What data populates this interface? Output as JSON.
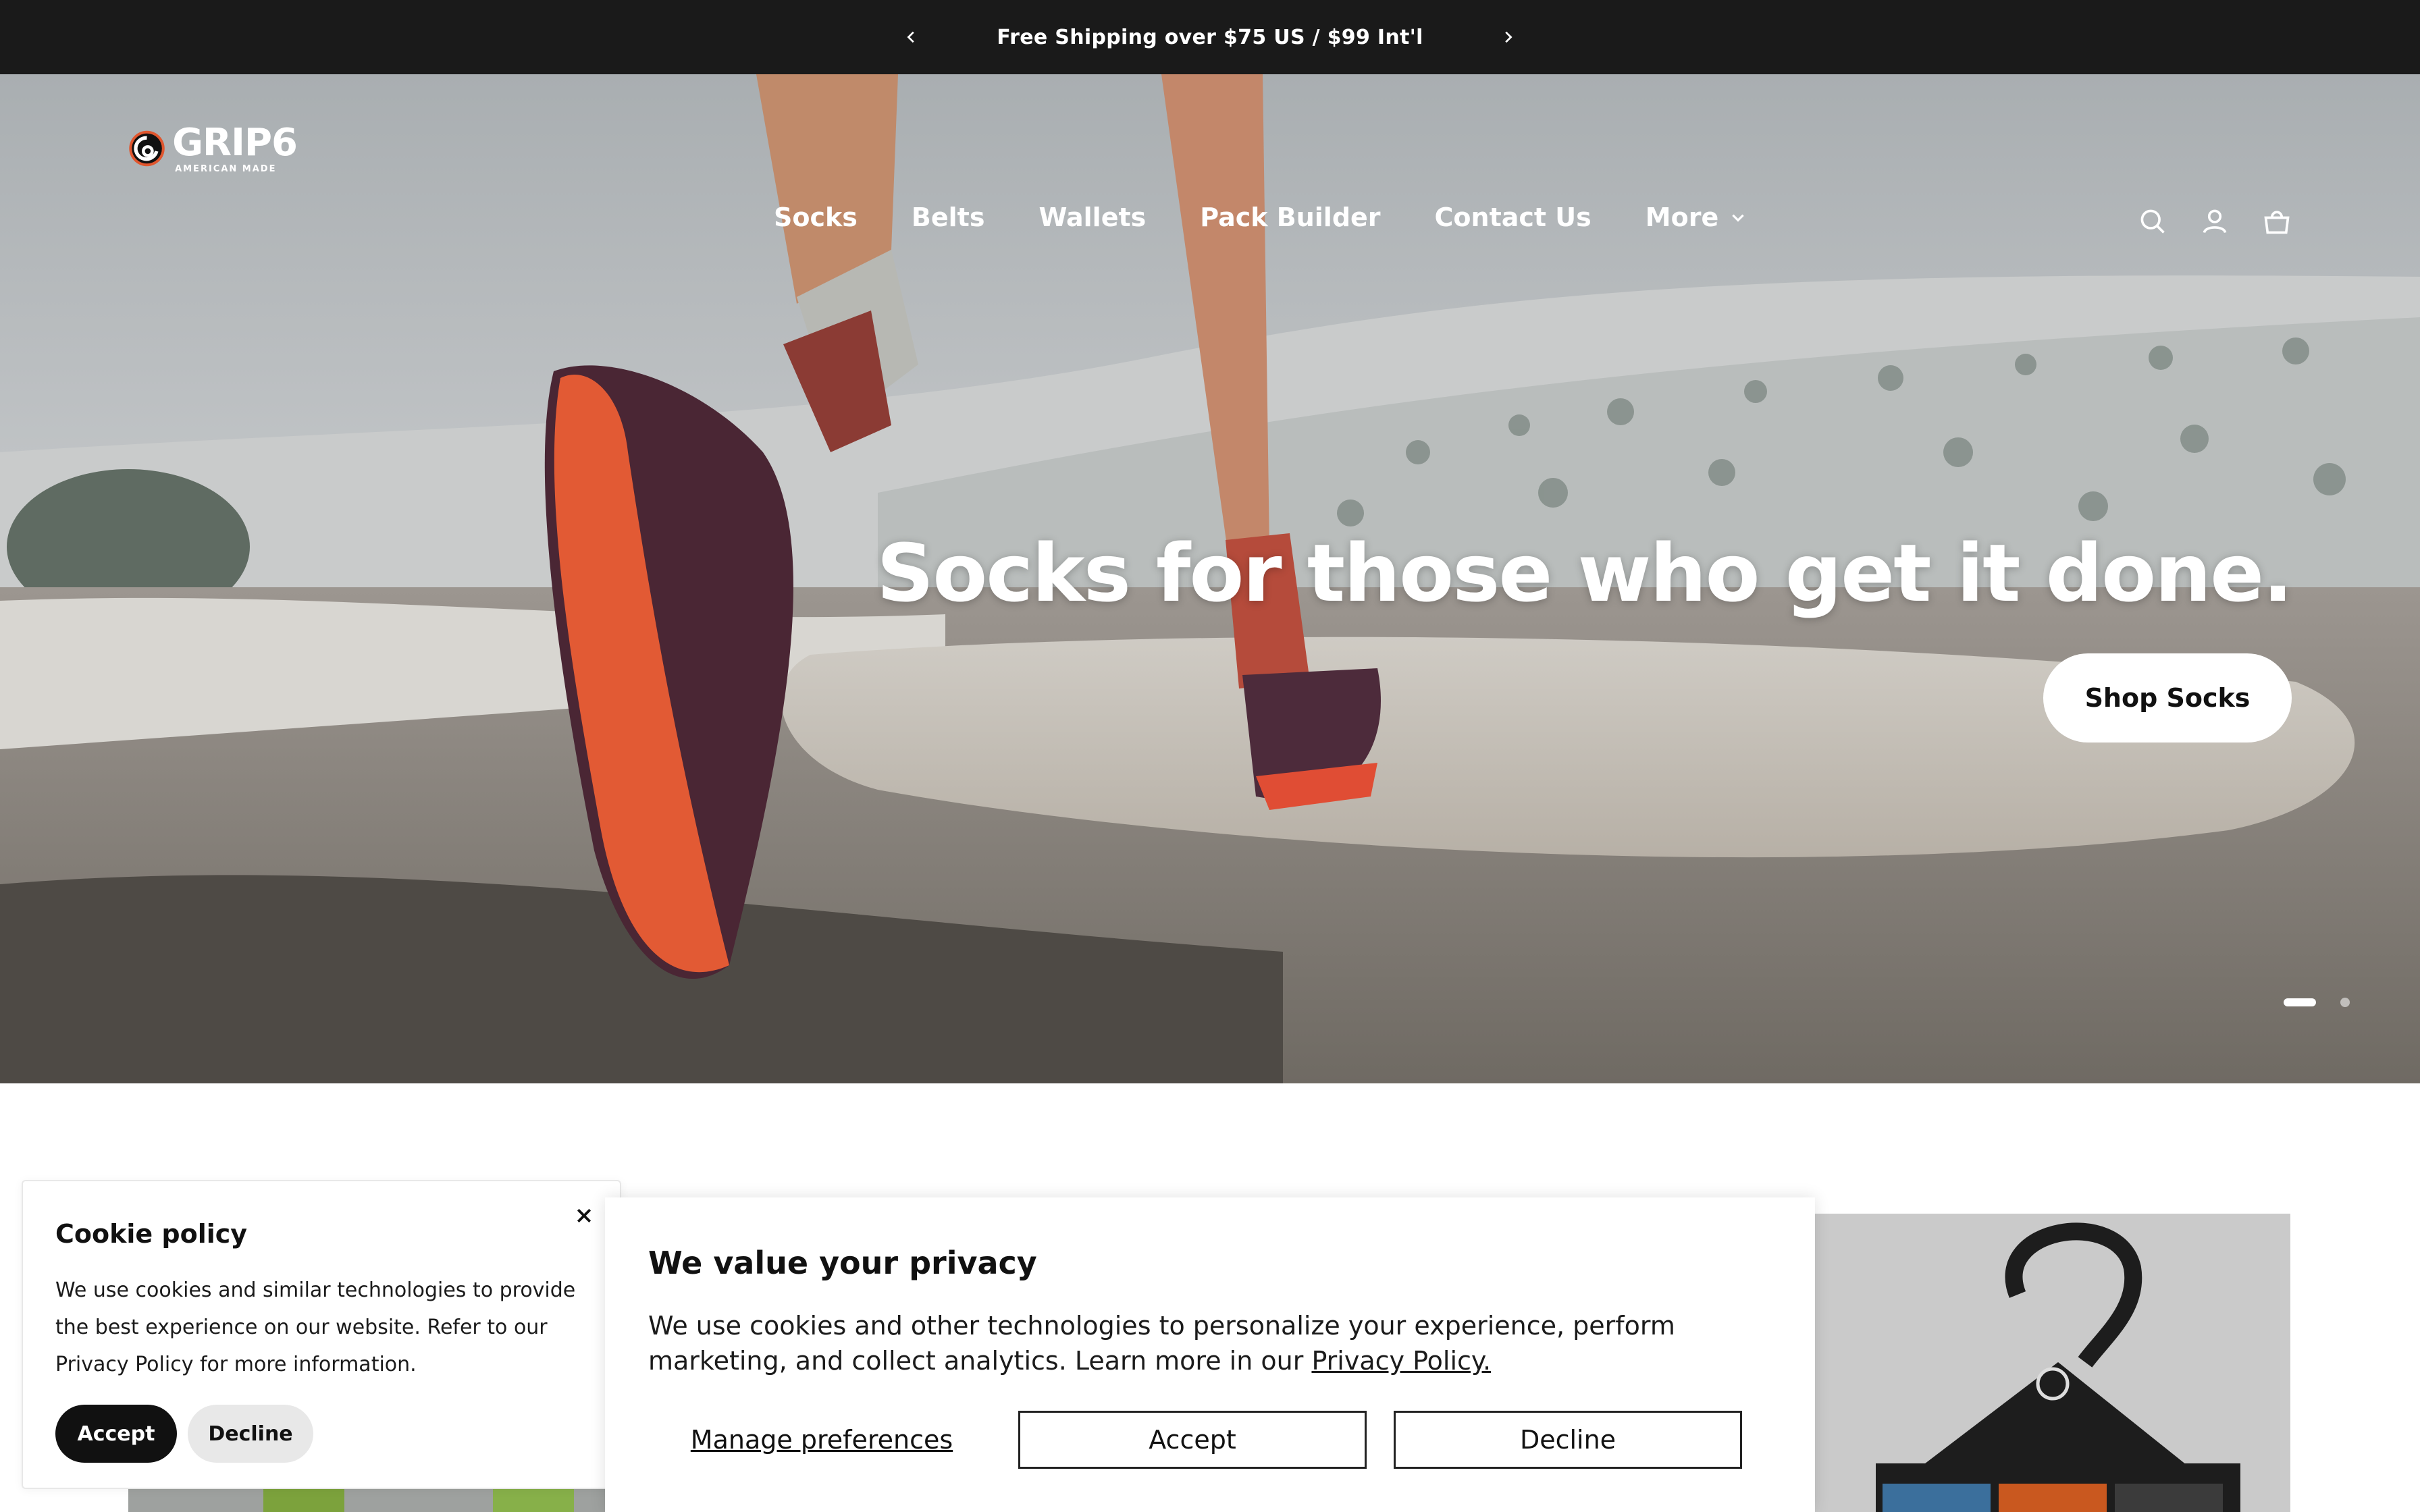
{
  "announcement": {
    "text": "Free Shipping over $75 US / $99 Int'l",
    "prev_icon": "chevron-left-icon",
    "next_icon": "chevron-right-icon"
  },
  "header": {
    "logo": {
      "word": "GRIP6",
      "tagline": "AMERICAN MADE"
    },
    "nav": [
      {
        "label": "Socks"
      },
      {
        "label": "Belts"
      },
      {
        "label": "Wallets"
      },
      {
        "label": "Pack Builder"
      },
      {
        "label": "Contact Us"
      },
      {
        "label": "More"
      }
    ],
    "icons": [
      "search-icon",
      "account-icon",
      "cart-icon"
    ]
  },
  "hero": {
    "title": "Socks for those who get it done.",
    "cta": "Shop Socks",
    "slides": 2,
    "active_slide": 1
  },
  "cookie_policy": {
    "title": "Cookie policy",
    "body": "We use cookies and similar technologies to provide the best experience on our website. Refer to our Privacy Policy for more information.",
    "accept": "Accept",
    "decline": "Decline"
  },
  "privacy_banner": {
    "title": "We value your privacy",
    "body": "We use cookies and other technologies to personalize your experience, perform marketing, and collect analytics. Learn more in our",
    "link": "Privacy Policy.",
    "manage": "Manage preferences",
    "accept": "Accept",
    "decline": "Decline"
  },
  "colors": {
    "announcement_bg": "#1a1a1a",
    "accent_orange": "#e0562e",
    "button_dark": "#111111"
  }
}
